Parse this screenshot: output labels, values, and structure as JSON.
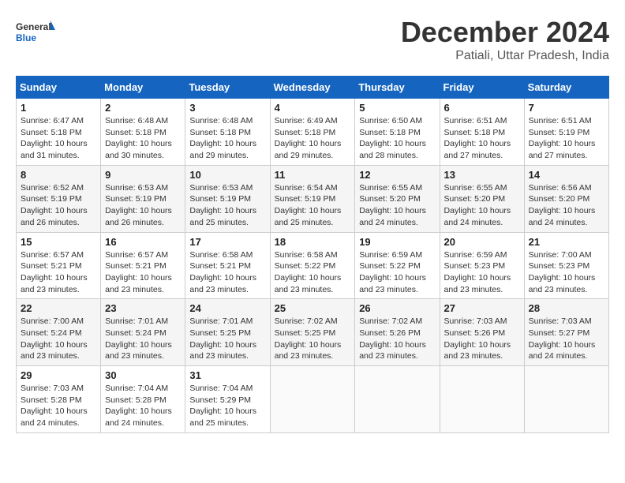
{
  "header": {
    "logo_general": "General",
    "logo_blue": "Blue",
    "month_title": "December 2024",
    "location": "Patiali, Uttar Pradesh, India"
  },
  "weekdays": [
    "Sunday",
    "Monday",
    "Tuesday",
    "Wednesday",
    "Thursday",
    "Friday",
    "Saturday"
  ],
  "weeks": [
    [
      {
        "day": "1",
        "sunrise": "6:47 AM",
        "sunset": "5:18 PM",
        "daylight": "10 hours and 31 minutes."
      },
      {
        "day": "2",
        "sunrise": "6:48 AM",
        "sunset": "5:18 PM",
        "daylight": "10 hours and 30 minutes."
      },
      {
        "day": "3",
        "sunrise": "6:48 AM",
        "sunset": "5:18 PM",
        "daylight": "10 hours and 29 minutes."
      },
      {
        "day": "4",
        "sunrise": "6:49 AM",
        "sunset": "5:18 PM",
        "daylight": "10 hours and 29 minutes."
      },
      {
        "day": "5",
        "sunrise": "6:50 AM",
        "sunset": "5:18 PM",
        "daylight": "10 hours and 28 minutes."
      },
      {
        "day": "6",
        "sunrise": "6:51 AM",
        "sunset": "5:18 PM",
        "daylight": "10 hours and 27 minutes."
      },
      {
        "day": "7",
        "sunrise": "6:51 AM",
        "sunset": "5:19 PM",
        "daylight": "10 hours and 27 minutes."
      }
    ],
    [
      {
        "day": "8",
        "sunrise": "6:52 AM",
        "sunset": "5:19 PM",
        "daylight": "10 hours and 26 minutes."
      },
      {
        "day": "9",
        "sunrise": "6:53 AM",
        "sunset": "5:19 PM",
        "daylight": "10 hours and 26 minutes."
      },
      {
        "day": "10",
        "sunrise": "6:53 AM",
        "sunset": "5:19 PM",
        "daylight": "10 hours and 25 minutes."
      },
      {
        "day": "11",
        "sunrise": "6:54 AM",
        "sunset": "5:19 PM",
        "daylight": "10 hours and 25 minutes."
      },
      {
        "day": "12",
        "sunrise": "6:55 AM",
        "sunset": "5:20 PM",
        "daylight": "10 hours and 24 minutes."
      },
      {
        "day": "13",
        "sunrise": "6:55 AM",
        "sunset": "5:20 PM",
        "daylight": "10 hours and 24 minutes."
      },
      {
        "day": "14",
        "sunrise": "6:56 AM",
        "sunset": "5:20 PM",
        "daylight": "10 hours and 24 minutes."
      }
    ],
    [
      {
        "day": "15",
        "sunrise": "6:57 AM",
        "sunset": "5:21 PM",
        "daylight": "10 hours and 23 minutes."
      },
      {
        "day": "16",
        "sunrise": "6:57 AM",
        "sunset": "5:21 PM",
        "daylight": "10 hours and 23 minutes."
      },
      {
        "day": "17",
        "sunrise": "6:58 AM",
        "sunset": "5:21 PM",
        "daylight": "10 hours and 23 minutes."
      },
      {
        "day": "18",
        "sunrise": "6:58 AM",
        "sunset": "5:22 PM",
        "daylight": "10 hours and 23 minutes."
      },
      {
        "day": "19",
        "sunrise": "6:59 AM",
        "sunset": "5:22 PM",
        "daylight": "10 hours and 23 minutes."
      },
      {
        "day": "20",
        "sunrise": "6:59 AM",
        "sunset": "5:23 PM",
        "daylight": "10 hours and 23 minutes."
      },
      {
        "day": "21",
        "sunrise": "7:00 AM",
        "sunset": "5:23 PM",
        "daylight": "10 hours and 23 minutes."
      }
    ],
    [
      {
        "day": "22",
        "sunrise": "7:00 AM",
        "sunset": "5:24 PM",
        "daylight": "10 hours and 23 minutes."
      },
      {
        "day": "23",
        "sunrise": "7:01 AM",
        "sunset": "5:24 PM",
        "daylight": "10 hours and 23 minutes."
      },
      {
        "day": "24",
        "sunrise": "7:01 AM",
        "sunset": "5:25 PM",
        "daylight": "10 hours and 23 minutes."
      },
      {
        "day": "25",
        "sunrise": "7:02 AM",
        "sunset": "5:25 PM",
        "daylight": "10 hours and 23 minutes."
      },
      {
        "day": "26",
        "sunrise": "7:02 AM",
        "sunset": "5:26 PM",
        "daylight": "10 hours and 23 minutes."
      },
      {
        "day": "27",
        "sunrise": "7:03 AM",
        "sunset": "5:26 PM",
        "daylight": "10 hours and 23 minutes."
      },
      {
        "day": "28",
        "sunrise": "7:03 AM",
        "sunset": "5:27 PM",
        "daylight": "10 hours and 24 minutes."
      }
    ],
    [
      {
        "day": "29",
        "sunrise": "7:03 AM",
        "sunset": "5:28 PM",
        "daylight": "10 hours and 24 minutes."
      },
      {
        "day": "30",
        "sunrise": "7:04 AM",
        "sunset": "5:28 PM",
        "daylight": "10 hours and 24 minutes."
      },
      {
        "day": "31",
        "sunrise": "7:04 AM",
        "sunset": "5:29 PM",
        "daylight": "10 hours and 25 minutes."
      },
      null,
      null,
      null,
      null
    ]
  ]
}
